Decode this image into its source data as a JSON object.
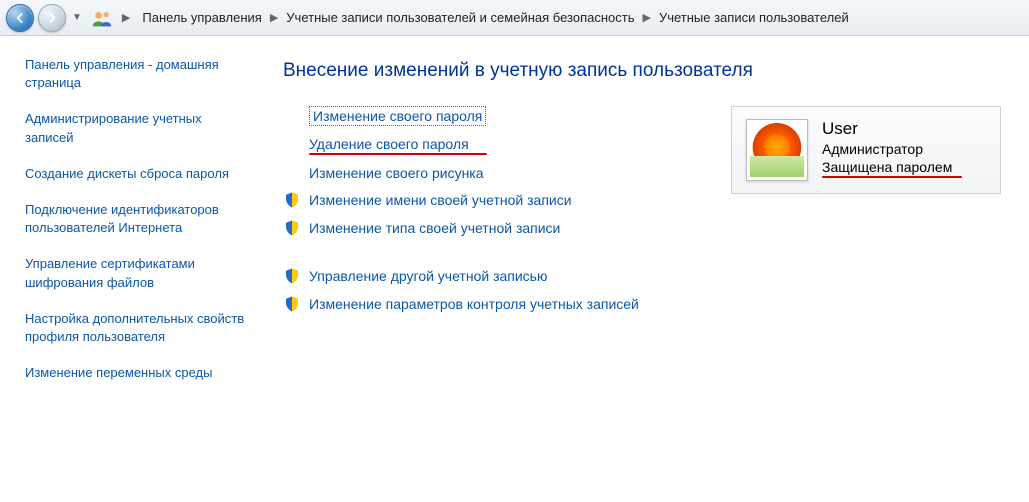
{
  "breadcrumb": {
    "items": [
      "Панель управления",
      "Учетные записи пользователей и семейная безопасность",
      "Учетные записи пользователей"
    ]
  },
  "sidebar": {
    "items": [
      "Панель управления - домашняя страница",
      "Администрирование учетных записей",
      "Создание дискеты сброса пароля",
      "Подключение идентификаторов пользователей Интернета",
      "Управление сертификатами шифрования файлов",
      "Настройка дополнительных свойств профиля пользователя",
      "Изменение переменных среды"
    ]
  },
  "main": {
    "heading": "Внесение изменений в учетную запись пользователя",
    "actions": [
      {
        "label": "Изменение своего пароля"
      },
      {
        "label": "Удаление своего пароля"
      },
      {
        "label": "Изменение своего рисунка"
      },
      {
        "label": "Изменение имени своей учетной записи"
      },
      {
        "label": "Изменение типа своей учетной записи"
      },
      {
        "label": "Управление другой учетной записью"
      },
      {
        "label": "Изменение параметров контроля учетных записей"
      }
    ],
    "account": {
      "name": "User",
      "role": "Администратор",
      "protected": "Защищена паролем"
    }
  }
}
